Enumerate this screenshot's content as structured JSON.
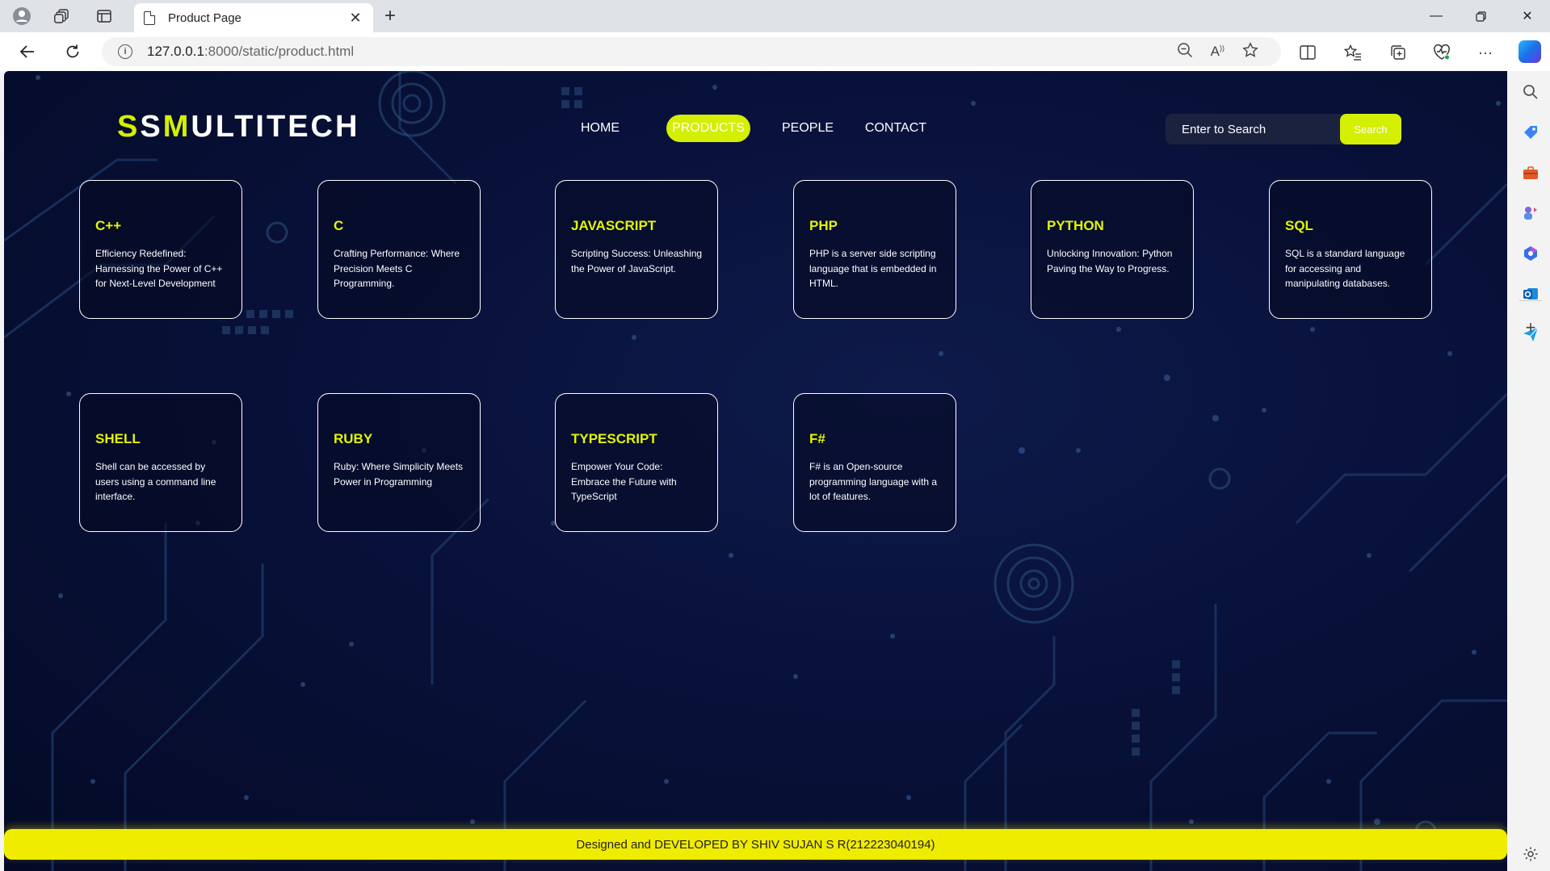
{
  "browser": {
    "tab_title": "Product Page",
    "url_host": "127.0.0.1",
    "url_path": ":8000/static/product.html"
  },
  "site": {
    "logo_accent1": "S",
    "logo_plain1": "S",
    "logo_accent2": "M",
    "logo_plain2": "ULTITECH",
    "nav": [
      "HOME",
      "PRODUCTS",
      "PEOPLE",
      "CONTACT"
    ],
    "active_nav": "PRODUCTS",
    "search_placeholder": "Enter to Search",
    "search_button": "Search",
    "accent_color": "#d4ef00",
    "footer": "Designed and DEVELOPED BY SHIV SUJAN S R(212223040194)"
  },
  "cards": [
    {
      "title": "C++",
      "text": "Efficiency Redefined: Harnessing the Power of C++ for Next-Level Development"
    },
    {
      "title": "C",
      "text": "Crafting Performance: Where Precision Meets C Programming."
    },
    {
      "title": "JAVASCRIPT",
      "text": "Scripting Success: Unleashing the Power of JavaScript."
    },
    {
      "title": "PHP",
      "text": "PHP is a server side scripting language that is embedded in HTML."
    },
    {
      "title": "PYTHON",
      "text": "Unlocking Innovation: Python Paving the Way to Progress."
    },
    {
      "title": "SQL",
      "text": "SQL is a standard language for accessing and manipulating databases."
    },
    {
      "title": "SHELL",
      "text": "Shell can be accessed by users using a command line interface."
    },
    {
      "title": "RUBY",
      "text": "Ruby: Where Simplicity Meets Power in Programming"
    },
    {
      "title": "TYPESCRIPT",
      "text": "Empower Your Code: Embrace the Future with TypeScript"
    },
    {
      "title": "F#",
      "text": "F# is an Open-source programming language with a lot of features."
    }
  ]
}
